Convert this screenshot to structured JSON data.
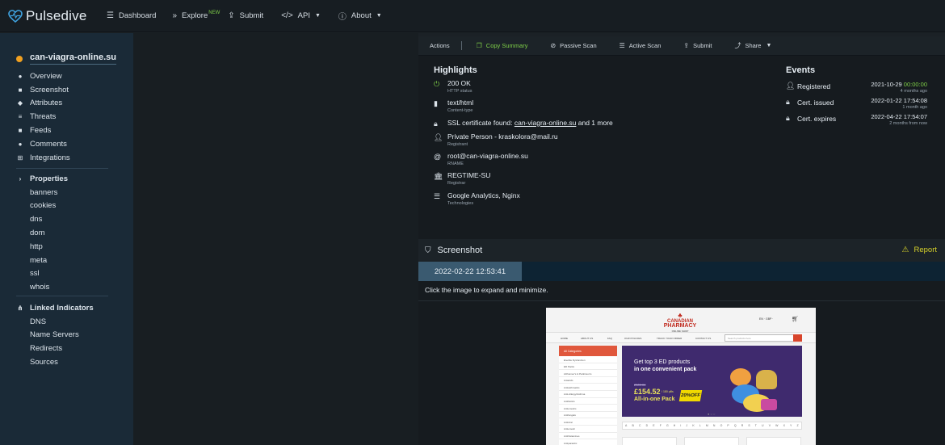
{
  "app": {
    "name": "Pulsedive",
    "nav": [
      {
        "label": "Dashboard",
        "icon": "menu-icon"
      },
      {
        "label": "Explore",
        "badge": "NEW",
        "icon": "chevrons-right-icon"
      },
      {
        "label": "Submit",
        "icon": "upload-icon"
      },
      {
        "label": "API",
        "icon": "code-icon"
      },
      {
        "label": "About",
        "icon": "info-icon"
      }
    ]
  },
  "sidebar": {
    "site": "can-viagra-online.su",
    "status_color": "#f0a020",
    "items": [
      "Overview",
      "Screenshot",
      "Attributes",
      "Threats",
      "Feeds",
      "Comments",
      "Integrations"
    ],
    "properties_label": "Properties",
    "properties": [
      "banners",
      "cookies",
      "dns",
      "dom",
      "http",
      "meta",
      "ssl",
      "whois"
    ],
    "linked_label": "Linked Indicators",
    "linked": [
      "DNS",
      "Name Servers",
      "Redirects",
      "Sources"
    ]
  },
  "actions": {
    "label": "Actions",
    "copy_summary": "Copy Summary",
    "passive_scan": "Passive Scan",
    "active_scan": "Active Scan",
    "submit": "Submit",
    "share": "Share"
  },
  "highlights": {
    "title": "Highlights",
    "http_status": "200 OK",
    "http_status_label": "HTTP status",
    "content_type": "text/html",
    "content_type_label": "Content-type",
    "ssl_prefix": "SSL certificate found: ",
    "ssl_link": "can-viagra-online.su",
    "ssl_suffix": " and 1 more",
    "registrant": "Private Person - kraskolora@mail.ru",
    "registrant_label": "Registrant",
    "rname": "root@can-viagra-online.su",
    "rname_label": "RNAME",
    "registrar": "REGTIME-SU",
    "registrar_label": "Registrar",
    "technologies": "Google Analytics, Nginx",
    "technologies_label": "Technologies"
  },
  "events": {
    "title": "Events",
    "registered_label": "Registered",
    "registered_date": "2021-10-29 ",
    "registered_time": "00:00:00",
    "registered_ago": "4 months ago",
    "issued_label": "Cert. issued",
    "issued_date": "2022-01-22 17:54:08",
    "issued_ago": "1 month ago",
    "expires_label": "Cert. expires",
    "expires_date": "2022-04-22 17:54:07",
    "expires_ago": "2 months from now"
  },
  "screenshot": {
    "title": "Screenshot",
    "report": "Report",
    "timestamp": "2022-02-22 12:53:41",
    "hint": "Click the image to expand and minimize."
  },
  "site_preview": {
    "brand_line1": "CANADIAN",
    "brand_line2": "PHARMACY",
    "brand_line3": "ONLINE SHOP",
    "top_right": "EN · GBP ·",
    "nav": [
      "HOME",
      "ABOUT US",
      "FAQ",
      "OUR POLICIES",
      "TRACK YOUR ORDER",
      "CONTACT US"
    ],
    "search_placeholder": "Search products here",
    "cats_head": "All Categories",
    "categories": [
      "Erectile Dysfunction",
      "ED Packs",
      "Alzheimer's & Parkinson's",
      "Antacids",
      "Antiasthmatics",
      "Anti-Allergy/Asthma",
      "Antibiotics",
      "Antiemetics",
      "Antifungals",
      "Antiviral",
      "Antiemetic",
      "Antihistamines",
      "Antiparasitic",
      "Antirheumatic",
      "Anxiety"
    ],
    "banner_line1": "Get top 3 ED products",
    "banner_line2": "in one convenient pack",
    "banner_old": "£309.04",
    "banner_price": "£154.52",
    "banner_per": "/ 180 pills",
    "banner_pack": "All-in-one Pack",
    "banner_off": "20%OFF",
    "alphabet": [
      "A",
      "B",
      "C",
      "D",
      "E",
      "F",
      "G",
      "H",
      "I",
      "J",
      "K",
      "L",
      "M",
      "N",
      "O",
      "P",
      "Q",
      "R",
      "S",
      "T",
      "U",
      "V",
      "W",
      "X",
      "Y",
      "Z"
    ]
  },
  "colors": {
    "accent_green": "#7fd048",
    "report_yellow": "#d6d12a",
    "sidebar_bg": "#1a2a37",
    "timestamp_tab": "#3a5a70"
  }
}
